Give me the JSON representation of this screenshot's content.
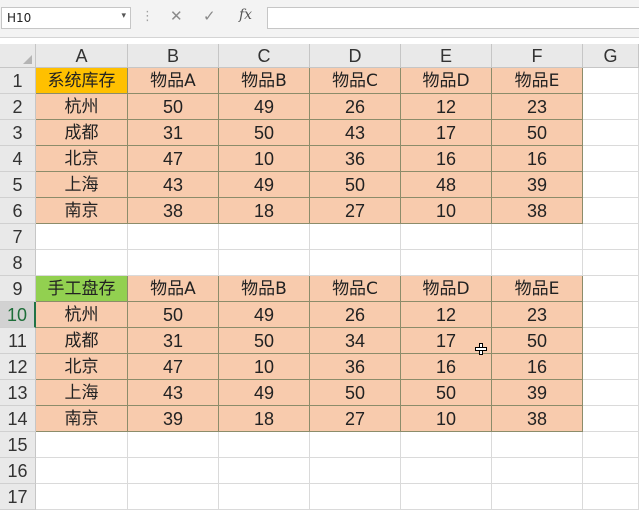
{
  "formula_bar": {
    "name_box": "H10",
    "name_box_dropdown": "▾",
    "dots": "⋮",
    "cancel": "✕",
    "enter": "✓",
    "fx": "fx",
    "formula": ""
  },
  "columns": [
    "A",
    "B",
    "C",
    "D",
    "E",
    "F",
    "G"
  ],
  "rows": [
    "1",
    "2",
    "3",
    "4",
    "5",
    "6",
    "7",
    "8",
    "9",
    "10",
    "11",
    "12",
    "13",
    "14",
    "15",
    "16",
    "17"
  ],
  "table1": {
    "corner_label": "系统库存",
    "corner_color": "#ffc000",
    "items": [
      "物品A",
      "物品B",
      "物品C",
      "物品D",
      "物品E"
    ],
    "cities": [
      "杭州",
      "成都",
      "北京",
      "上海",
      "南京"
    ],
    "values": [
      [
        50,
        49,
        26,
        12,
        23
      ],
      [
        31,
        50,
        43,
        17,
        50
      ],
      [
        47,
        10,
        36,
        16,
        16
      ],
      [
        43,
        49,
        50,
        48,
        39
      ],
      [
        38,
        18,
        27,
        10,
        38
      ]
    ]
  },
  "table2": {
    "corner_label": "手工盘存",
    "corner_color": "#92d050",
    "items": [
      "物品A",
      "物品B",
      "物品C",
      "物品D",
      "物品E"
    ],
    "cities": [
      "杭州",
      "成都",
      "北京",
      "上海",
      "南京"
    ],
    "values": [
      [
        50,
        49,
        26,
        12,
        23
      ],
      [
        31,
        50,
        34,
        17,
        50
      ],
      [
        47,
        10,
        36,
        16,
        16
      ],
      [
        43,
        49,
        50,
        50,
        39
      ],
      [
        39,
        18,
        27,
        10,
        38
      ]
    ]
  },
  "fill_color": "#f8cbad",
  "selected_cell": "H10"
}
